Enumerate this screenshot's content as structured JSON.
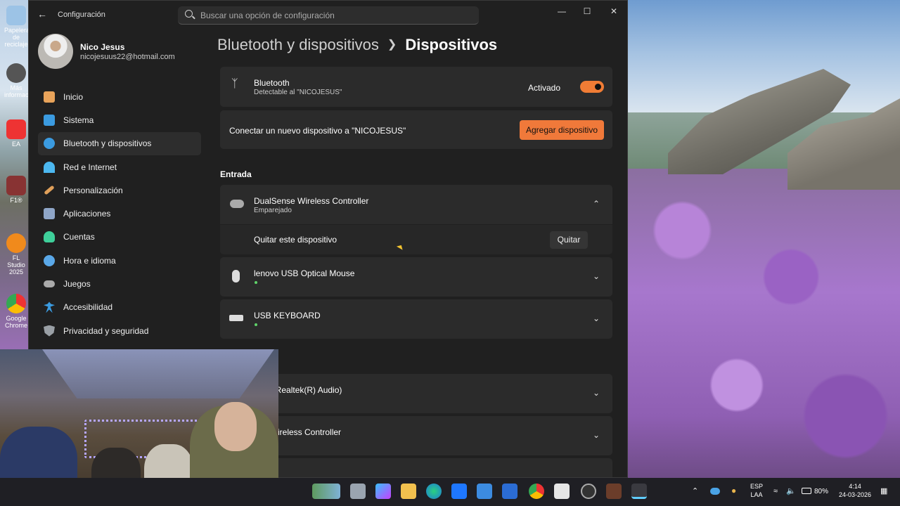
{
  "window": {
    "title": "Configuración"
  },
  "search": {
    "placeholder": "Buscar una opción de configuración"
  },
  "profile": {
    "name": "Nico Jesus",
    "email": "nicojesuus22@hotmail.com"
  },
  "sidebar": {
    "items": [
      {
        "label": "Inicio",
        "icon": "home-icon",
        "color": "#e8a35a"
      },
      {
        "label": "Sistema",
        "icon": "system-icon",
        "color": "#3b9be0"
      },
      {
        "label": "Bluetooth y dispositivos",
        "icon": "bluetooth-icon",
        "color": "#3b9be0",
        "active": true
      },
      {
        "label": "Red e Internet",
        "icon": "wifi-icon",
        "color": "#4cb8f0"
      },
      {
        "label": "Personalización",
        "icon": "brush-icon",
        "color": "#e0a05a"
      },
      {
        "label": "Aplicaciones",
        "icon": "apps-icon",
        "color": "#8fa6c8"
      },
      {
        "label": "Cuentas",
        "icon": "account-icon",
        "color": "#3ecf9a"
      },
      {
        "label": "Hora e idioma",
        "icon": "clock-globe-icon",
        "color": "#5aa8e8"
      },
      {
        "label": "Juegos",
        "icon": "gamepad-icon",
        "color": "#aaaaaa"
      },
      {
        "label": "Accesibilidad",
        "icon": "accessibility-icon",
        "color": "#3b9be0"
      },
      {
        "label": "Privacidad y seguridad",
        "icon": "shield-icon",
        "color": "#9aa0a6"
      }
    ]
  },
  "breadcrumb": {
    "parent": "Bluetooth y dispositivos",
    "current": "Dispositivos"
  },
  "bluetooth": {
    "title": "Bluetooth",
    "subtitle": "Detectable al \"NICOJESUS\"",
    "state_label": "Activado"
  },
  "add_device": {
    "text": "Conectar un nuevo dispositivo a \"NICOJESUS\"",
    "button": "Agregar dispositivo"
  },
  "input_section": {
    "title": "Entrada",
    "devices": [
      {
        "name": "DualSense Wireless Controller",
        "status": "Emparejado",
        "expanded": true,
        "remove_text": "Quitar este dispositivo",
        "remove_button": "Quitar"
      },
      {
        "name": "lenovo USB Optical Mouse",
        "connected": true
      },
      {
        "name": "USB KEYBOARD",
        "connected": true
      }
    ]
  },
  "other_devices": [
    {
      "name": "ares (Realtek(R) Audio)"
    },
    {
      "name": "nse Wireless Controller"
    }
  ],
  "taskbar": {
    "lang_top": "ESP",
    "lang_bottom": "LAA",
    "battery": "80%",
    "time": "4:14",
    "date": "24-03-2026"
  },
  "desktop_icons": [
    "Papelera de reciclaje",
    "Más información",
    "EA",
    "F1®",
    "FL Studio 2025",
    "Google Chrome"
  ],
  "colors": {
    "accent": "#f07c35"
  }
}
